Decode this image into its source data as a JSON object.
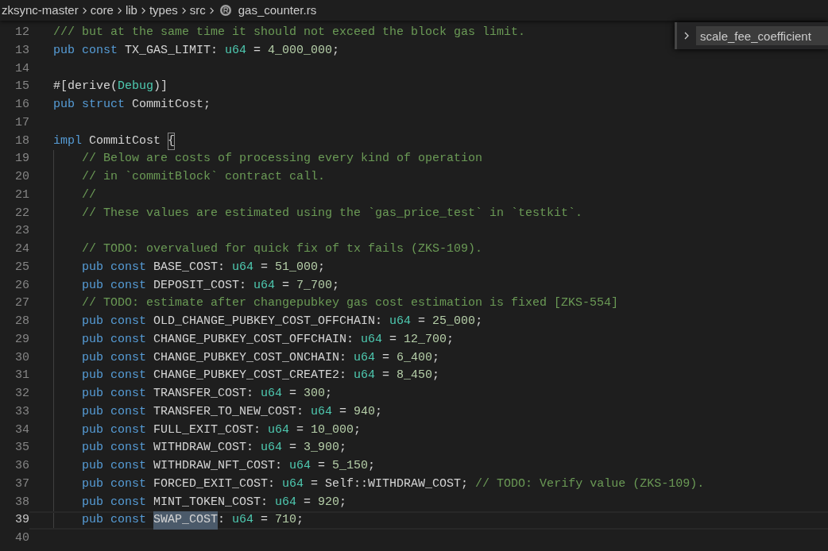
{
  "breadcrumb": [
    {
      "label": "zksync-master",
      "kind": "folder"
    },
    {
      "label": "core",
      "kind": "folder"
    },
    {
      "label": "lib",
      "kind": "folder"
    },
    {
      "label": "types",
      "kind": "folder"
    },
    {
      "label": "src",
      "kind": "folder"
    },
    {
      "label": "gas_counter.rs",
      "kind": "file"
    }
  ],
  "find_widget": {
    "value": "scale_fee_coefficient",
    "expanded": false
  },
  "lines": [
    {
      "number": "12",
      "indented": false,
      "current": false,
      "tokens": [
        {
          "text": "/// but at the same time it should not exceed the block gas limit.",
          "kind": "comment"
        }
      ]
    },
    {
      "number": "13",
      "indented": false,
      "current": false,
      "tokens": [
        {
          "text": "pub const",
          "kind": "keyword"
        },
        {
          "text": " TX_GAS_LIMIT: ",
          "kind": "plain"
        },
        {
          "text": "u64",
          "kind": "type"
        },
        {
          "text": " = ",
          "kind": "plain"
        },
        {
          "text": "4_000_000",
          "kind": "number"
        },
        {
          "text": ";",
          "kind": "plain"
        }
      ]
    },
    {
      "number": "14",
      "indented": false,
      "current": false
    },
    {
      "number": "15",
      "indented": false,
      "current": false,
      "tokens": [
        {
          "text": "#[derive(",
          "kind": "plain"
        },
        {
          "text": "Debug",
          "kind": "type"
        },
        {
          "text": ")]",
          "kind": "plain"
        }
      ]
    },
    {
      "number": "16",
      "indented": false,
      "current": false,
      "tokens": [
        {
          "text": "pub struct",
          "kind": "keyword"
        },
        {
          "text": " CommitCost;",
          "kind": "plain"
        }
      ]
    },
    {
      "number": "17",
      "indented": false,
      "current": false
    },
    {
      "number": "18",
      "indented": false,
      "current": false,
      "tokens": [
        {
          "text": "impl",
          "kind": "keyword"
        },
        {
          "text": " CommitCost ",
          "kind": "plain"
        },
        {
          "text": "{",
          "kind": "bracket-match"
        }
      ]
    },
    {
      "number": "19",
      "indented": true,
      "current": false,
      "tokens": [
        {
          "text": "// Below are costs of processing every kind of operation",
          "kind": "comment"
        }
      ]
    },
    {
      "number": "20",
      "indented": true,
      "current": false,
      "tokens": [
        {
          "text": "// in `commitBlock` contract call.",
          "kind": "comment"
        }
      ]
    },
    {
      "number": "21",
      "indented": true,
      "current": false,
      "tokens": [
        {
          "text": "//",
          "kind": "comment"
        }
      ]
    },
    {
      "number": "22",
      "indented": true,
      "current": false,
      "tokens": [
        {
          "text": "// These values are estimated using the `gas_price_test` in `testkit`.",
          "kind": "comment"
        }
      ]
    },
    {
      "number": "23",
      "indented": true,
      "current": false
    },
    {
      "number": "24",
      "indented": true,
      "current": false,
      "tokens": [
        {
          "text": "// TODO: overvalued for quick fix of tx fails (ZKS-109).",
          "kind": "comment"
        }
      ]
    },
    {
      "number": "25",
      "indented": true,
      "current": false,
      "tokens": [
        {
          "text": "pub const",
          "kind": "keyword"
        },
        {
          "text": " BASE_COST: ",
          "kind": "plain"
        },
        {
          "text": "u64",
          "kind": "type"
        },
        {
          "text": " = ",
          "kind": "plain"
        },
        {
          "text": "51_000",
          "kind": "number"
        },
        {
          "text": ";",
          "kind": "plain"
        }
      ]
    },
    {
      "number": "26",
      "indented": true,
      "current": false,
      "tokens": [
        {
          "text": "pub const",
          "kind": "keyword"
        },
        {
          "text": " DEPOSIT_COST: ",
          "kind": "plain"
        },
        {
          "text": "u64",
          "kind": "type"
        },
        {
          "text": " = ",
          "kind": "plain"
        },
        {
          "text": "7_700",
          "kind": "number"
        },
        {
          "text": ";",
          "kind": "plain"
        }
      ]
    },
    {
      "number": "27",
      "indented": true,
      "current": false,
      "tokens": [
        {
          "text": "// TODO: estimate after changepubkey gas cost estimation is fixed [ZKS-554]",
          "kind": "comment"
        }
      ]
    },
    {
      "number": "28",
      "indented": true,
      "current": false,
      "tokens": [
        {
          "text": "pub const",
          "kind": "keyword"
        },
        {
          "text": " OLD_CHANGE_PUBKEY_COST_OFFCHAIN: ",
          "kind": "plain"
        },
        {
          "text": "u64",
          "kind": "type"
        },
        {
          "text": " = ",
          "kind": "plain"
        },
        {
          "text": "25_000",
          "kind": "number"
        },
        {
          "text": ";",
          "kind": "plain"
        }
      ]
    },
    {
      "number": "29",
      "indented": true,
      "current": false,
      "tokens": [
        {
          "text": "pub const",
          "kind": "keyword"
        },
        {
          "text": " CHANGE_PUBKEY_COST_OFFCHAIN: ",
          "kind": "plain"
        },
        {
          "text": "u64",
          "kind": "type"
        },
        {
          "text": " = ",
          "kind": "plain"
        },
        {
          "text": "12_700",
          "kind": "number"
        },
        {
          "text": ";",
          "kind": "plain"
        }
      ]
    },
    {
      "number": "30",
      "indented": true,
      "current": false,
      "tokens": [
        {
          "text": "pub const",
          "kind": "keyword"
        },
        {
          "text": " CHANGE_PUBKEY_COST_ONCHAIN: ",
          "kind": "plain"
        },
        {
          "text": "u64",
          "kind": "type"
        },
        {
          "text": " = ",
          "kind": "plain"
        },
        {
          "text": "6_400",
          "kind": "number"
        },
        {
          "text": ";",
          "kind": "plain"
        }
      ]
    },
    {
      "number": "31",
      "indented": true,
      "current": false,
      "tokens": [
        {
          "text": "pub const",
          "kind": "keyword"
        },
        {
          "text": " CHANGE_PUBKEY_COST_CREATE2: ",
          "kind": "plain"
        },
        {
          "text": "u64",
          "kind": "type"
        },
        {
          "text": " = ",
          "kind": "plain"
        },
        {
          "text": "8_450",
          "kind": "number"
        },
        {
          "text": ";",
          "kind": "plain"
        }
      ]
    },
    {
      "number": "32",
      "indented": true,
      "current": false,
      "tokens": [
        {
          "text": "pub const",
          "kind": "keyword"
        },
        {
          "text": " TRANSFER_COST: ",
          "kind": "plain"
        },
        {
          "text": "u64",
          "kind": "type"
        },
        {
          "text": " = ",
          "kind": "plain"
        },
        {
          "text": "300",
          "kind": "number"
        },
        {
          "text": ";",
          "kind": "plain"
        }
      ]
    },
    {
      "number": "33",
      "indented": true,
      "current": false,
      "tokens": [
        {
          "text": "pub const",
          "kind": "keyword"
        },
        {
          "text": " TRANSFER_TO_NEW_COST: ",
          "kind": "plain"
        },
        {
          "text": "u64",
          "kind": "type"
        },
        {
          "text": " = ",
          "kind": "plain"
        },
        {
          "text": "940",
          "kind": "number"
        },
        {
          "text": ";",
          "kind": "plain"
        }
      ]
    },
    {
      "number": "34",
      "indented": true,
      "current": false,
      "tokens": [
        {
          "text": "pub const",
          "kind": "keyword"
        },
        {
          "text": " FULL_EXIT_COST: ",
          "kind": "plain"
        },
        {
          "text": "u64",
          "kind": "type"
        },
        {
          "text": " = ",
          "kind": "plain"
        },
        {
          "text": "10_000",
          "kind": "number"
        },
        {
          "text": ";",
          "kind": "plain"
        }
      ]
    },
    {
      "number": "35",
      "indented": true,
      "current": false,
      "tokens": [
        {
          "text": "pub const",
          "kind": "keyword"
        },
        {
          "text": " WITHDRAW_COST: ",
          "kind": "plain"
        },
        {
          "text": "u64",
          "kind": "type"
        },
        {
          "text": " = ",
          "kind": "plain"
        },
        {
          "text": "3_900",
          "kind": "number"
        },
        {
          "text": ";",
          "kind": "plain"
        }
      ]
    },
    {
      "number": "36",
      "indented": true,
      "current": false,
      "tokens": [
        {
          "text": "pub const",
          "kind": "keyword"
        },
        {
          "text": " WITHDRAW_NFT_COST: ",
          "kind": "plain"
        },
        {
          "text": "u64",
          "kind": "type"
        },
        {
          "text": " = ",
          "kind": "plain"
        },
        {
          "text": "5_150",
          "kind": "number"
        },
        {
          "text": ";",
          "kind": "plain"
        }
      ]
    },
    {
      "number": "37",
      "indented": true,
      "current": false,
      "tokens": [
        {
          "text": "pub const",
          "kind": "keyword"
        },
        {
          "text": " FORCED_EXIT_COST: ",
          "kind": "plain"
        },
        {
          "text": "u64",
          "kind": "type"
        },
        {
          "text": " = Self::WITHDRAW_COST; ",
          "kind": "plain"
        },
        {
          "text": "// TODO: Verify value (ZKS-109).",
          "kind": "comment"
        }
      ]
    },
    {
      "number": "38",
      "indented": true,
      "current": false,
      "tokens": [
        {
          "text": "pub const",
          "kind": "keyword"
        },
        {
          "text": " MINT_TOKEN_COST: ",
          "kind": "plain"
        },
        {
          "text": "u64",
          "kind": "type"
        },
        {
          "text": " = ",
          "kind": "plain"
        },
        {
          "text": "920",
          "kind": "number"
        },
        {
          "text": ";",
          "kind": "plain"
        }
      ]
    },
    {
      "number": "39",
      "indented": true,
      "current": true,
      "tokens": [
        {
          "text": "pub const ",
          "kind": "keyword"
        },
        {
          "text": "SWAP_COST",
          "kind": "selection"
        },
        {
          "text": ": ",
          "kind": "plain"
        },
        {
          "text": "u64",
          "kind": "type"
        },
        {
          "text": " = ",
          "kind": "plain"
        },
        {
          "text": "710",
          "kind": "number"
        },
        {
          "text": ";",
          "kind": "plain"
        }
      ]
    },
    {
      "number": "40",
      "indented": false,
      "current": false
    }
  ]
}
